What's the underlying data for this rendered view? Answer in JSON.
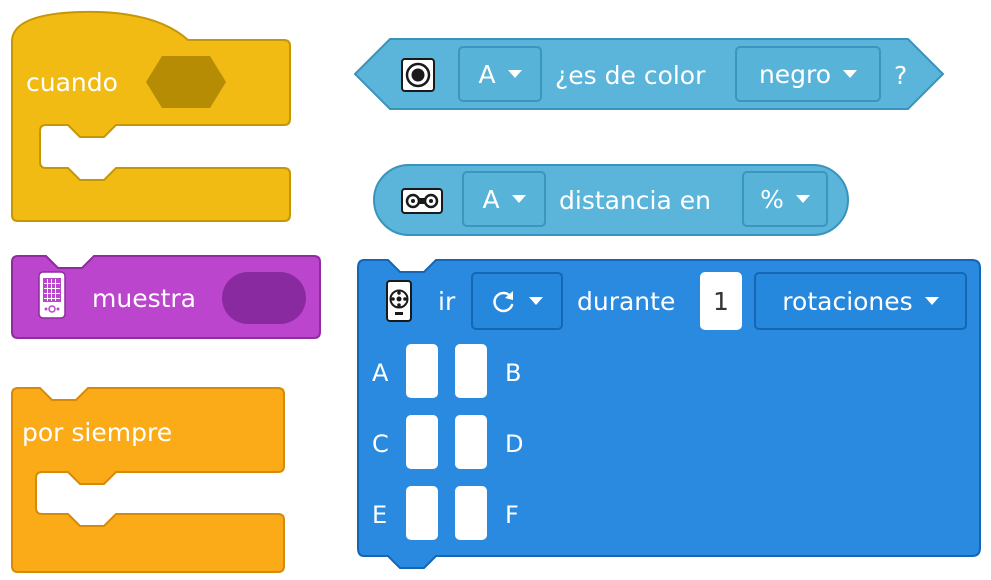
{
  "colors": {
    "event": "#f1bb14",
    "event_dark": "#c59606",
    "event_hex": "#b58c04",
    "display": "#bb45cc",
    "display_dark": "#8f2ca0",
    "display_slot": "#8a2aa0",
    "control": "#fcab18",
    "control_dark": "#d68a0a",
    "sensor": "#5bb4d9",
    "sensor_dark": "#3a93bd",
    "motor": "#2a8ae0",
    "motor_dark": "#1565b5"
  },
  "when_block": {
    "label": "cuando"
  },
  "display_block": {
    "label": "muestra",
    "icon": "light-matrix-icon"
  },
  "forever_block": {
    "label": "por siempre"
  },
  "color_sensor_block": {
    "icon": "color-sensor-icon",
    "port": "A",
    "text": "¿es de color",
    "color": "negro",
    "suffix": "?"
  },
  "distance_block": {
    "icon": "distance-sensor-icon",
    "port": "A",
    "text": "distancia en",
    "unit": "%"
  },
  "motor_block": {
    "icon": "motor-icon",
    "verb": "ir",
    "direction_icon": "rotate-clockwise-icon",
    "during": "durante",
    "amount": "1",
    "unit": "rotaciones",
    "ports": [
      "A",
      "B",
      "C",
      "D",
      "E",
      "F"
    ]
  }
}
